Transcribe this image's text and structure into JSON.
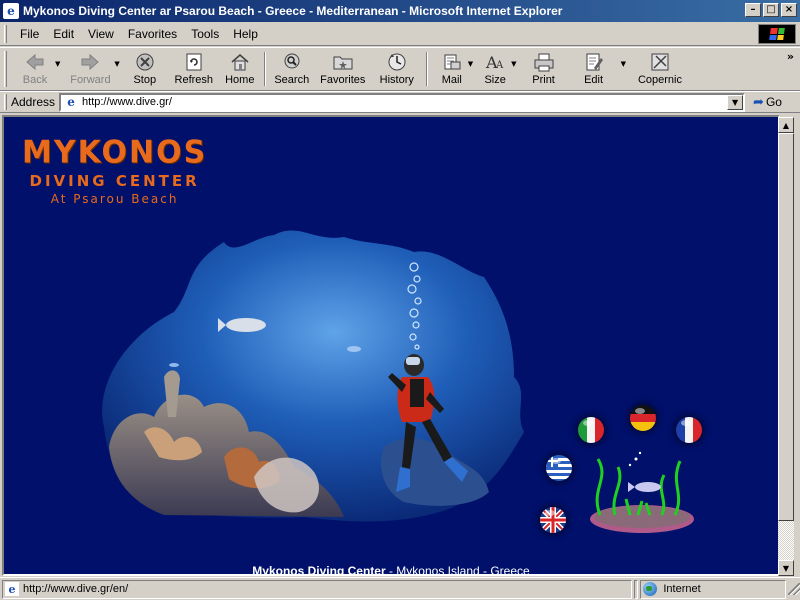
{
  "window": {
    "title": "Mykonos Diving Center ar Psarou Beach - Greece - Mediterranean - Microsoft Internet Explorer",
    "min_label": "_",
    "max_label": "□",
    "close_label": "×"
  },
  "menu": {
    "items": [
      {
        "label": "File"
      },
      {
        "label": "Edit"
      },
      {
        "label": "View"
      },
      {
        "label": "Favorites"
      },
      {
        "label": "Tools"
      },
      {
        "label": "Help"
      }
    ]
  },
  "toolbar": {
    "back": "Back",
    "forward": "Forward",
    "stop": "Stop",
    "refresh": "Refresh",
    "home": "Home",
    "search": "Search",
    "favorites": "Favorites",
    "history": "History",
    "mail": "Mail",
    "size": "Size",
    "print": "Print",
    "edit": "Edit",
    "copernic": "Copernic",
    "chevron": "»"
  },
  "address": {
    "label": "Address",
    "url": "http://www.dive.gr/",
    "go_label": "Go"
  },
  "page": {
    "logo_line1": "MYKONOS",
    "logo_line2": "DIVING CENTER",
    "logo_line3": "At Psarou Beach",
    "footer_bold": "Mykonos Diving Center",
    "footer_rest": " - Mykonos Island - Greece",
    "languages": [
      "Italian",
      "German",
      "French",
      "Greek",
      "English"
    ]
  },
  "status": {
    "text": "http://www.dive.gr/en/",
    "zone": "Internet"
  },
  "colors": {
    "page_background": "#00106b",
    "logo_orange": "#e86a1c",
    "titlebar_start": "#0a246a",
    "titlebar_end": "#3a6ea5"
  }
}
